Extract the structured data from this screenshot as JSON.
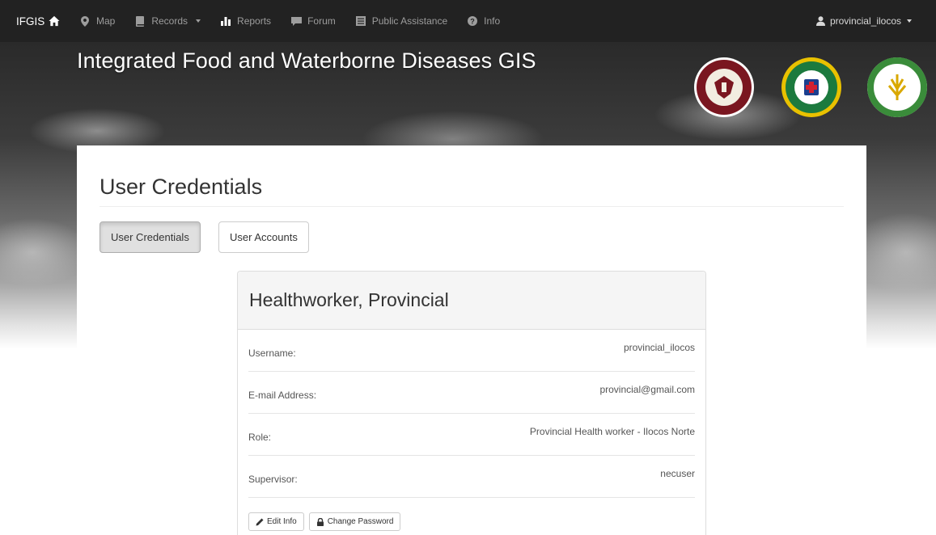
{
  "navbar": {
    "brand": "IFGIS",
    "items": [
      {
        "label": "Map",
        "icon": "map-marker-icon"
      },
      {
        "label": "Records",
        "icon": "book-icon",
        "dropdown": true
      },
      {
        "label": "Reports",
        "icon": "bar-chart-icon"
      },
      {
        "label": "Forum",
        "icon": "comment-icon"
      },
      {
        "label": "Public Assistance",
        "icon": "list-alt-icon"
      },
      {
        "label": "Info",
        "icon": "question-sign-icon"
      }
    ],
    "user": "provincial_ilocos"
  },
  "banner": {
    "title": "Integrated Food and Waterborne Diseases GIS",
    "seals": [
      "up-manila-seal",
      "department-of-health-seal",
      "department-of-agriculture-seal"
    ]
  },
  "page": {
    "title": "User Credentials",
    "tabs": [
      {
        "label": "User Credentials",
        "active": true
      },
      {
        "label": "User Accounts",
        "active": false
      }
    ]
  },
  "card": {
    "name": "Healthworker, Provincial",
    "fields": [
      {
        "label": "Username:",
        "value": "provincial_ilocos"
      },
      {
        "label": "E-mail Address:",
        "value": "provincial@gmail.com"
      },
      {
        "label": "Role:",
        "value": "Provincial Health worker - Ilocos Norte"
      },
      {
        "label": "Supervisor:",
        "value": "necuser"
      }
    ],
    "buttons": {
      "edit": "Edit Info",
      "password": "Change Password"
    }
  },
  "colors": {
    "navbar_bg": "#222222",
    "nav_text": "#9d9d9d",
    "panel_bg": "#ffffff",
    "card_header_bg": "#f5f5f5"
  }
}
